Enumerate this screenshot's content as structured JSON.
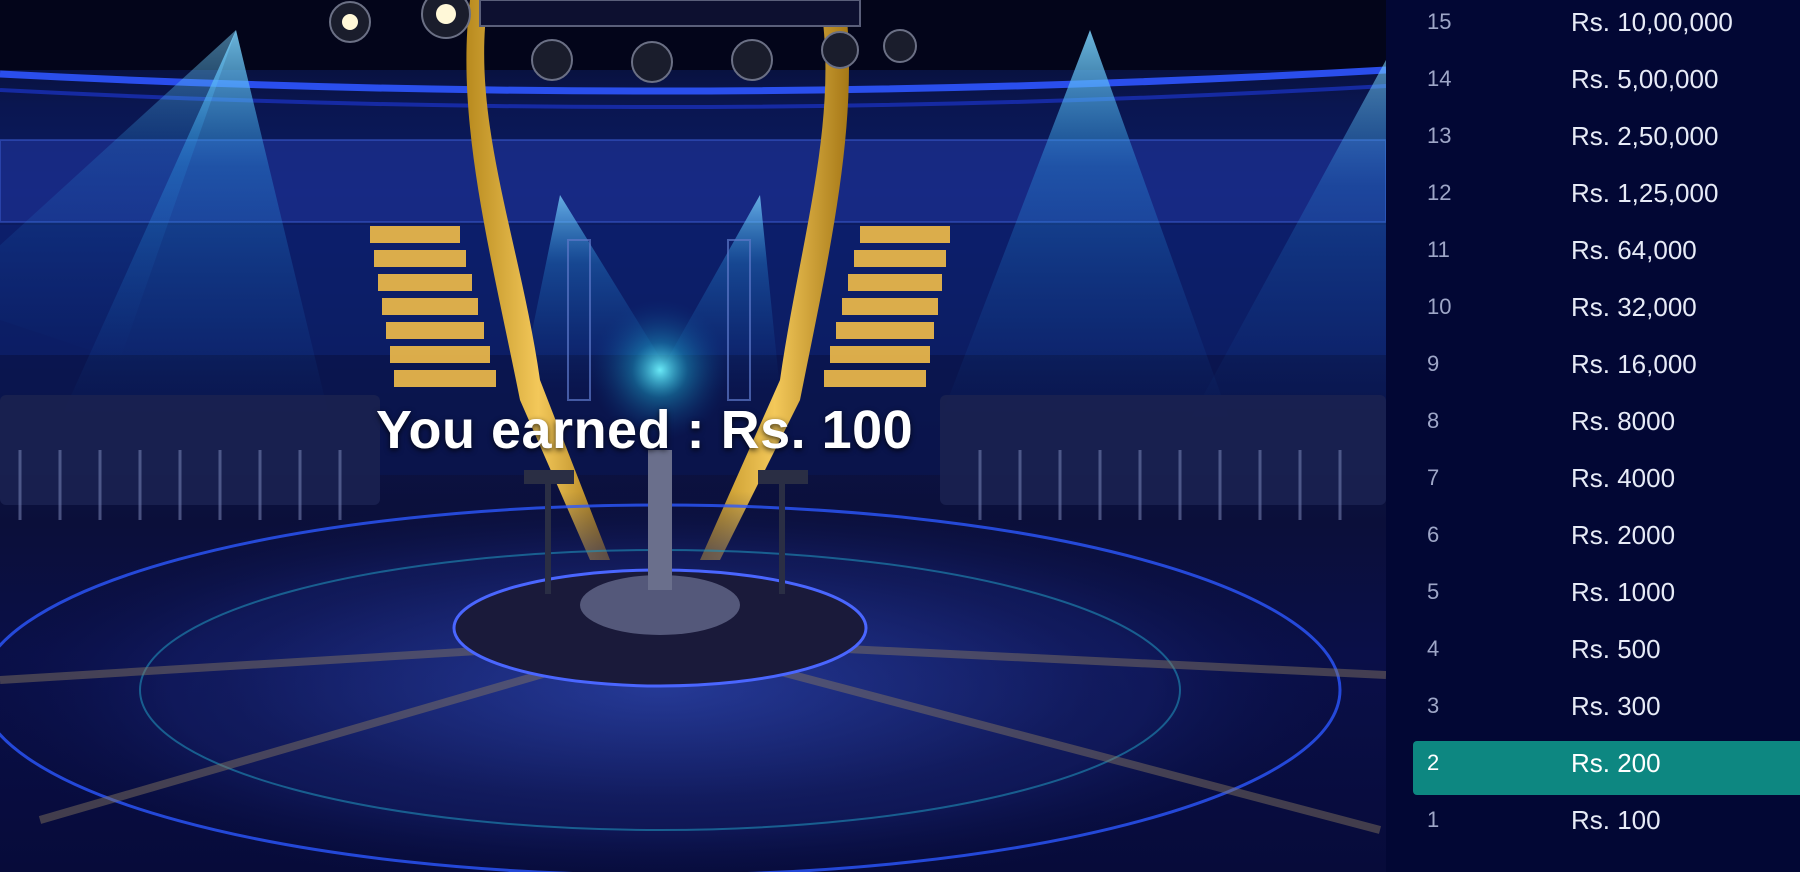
{
  "earned": {
    "label": "You earned :",
    "amount": "Rs. 100"
  },
  "ladder": {
    "current_level": 2,
    "rows": [
      {
        "level": "15",
        "amount": "Rs. 10,00,000"
      },
      {
        "level": "14",
        "amount": "Rs. 5,00,000"
      },
      {
        "level": "13",
        "amount": "Rs. 2,50,000"
      },
      {
        "level": "12",
        "amount": "Rs. 1,25,000"
      },
      {
        "level": "11",
        "amount": "Rs. 64,000"
      },
      {
        "level": "10",
        "amount": "Rs. 32,000"
      },
      {
        "level": "9",
        "amount": "Rs. 16,000"
      },
      {
        "level": "8",
        "amount": "Rs. 8000"
      },
      {
        "level": "7",
        "amount": "Rs. 4000"
      },
      {
        "level": "6",
        "amount": "Rs. 2000"
      },
      {
        "level": "5",
        "amount": "Rs. 1000"
      },
      {
        "level": "4",
        "amount": "Rs. 500"
      },
      {
        "level": "3",
        "amount": "Rs. 300"
      },
      {
        "level": "2",
        "amount": "Rs. 200"
      },
      {
        "level": "1",
        "amount": "Rs. 100"
      }
    ]
  },
  "colors": {
    "ladder_background": "#020734",
    "current_level_highlight": "#0d8781",
    "stage_blue": "#0b1b63"
  }
}
